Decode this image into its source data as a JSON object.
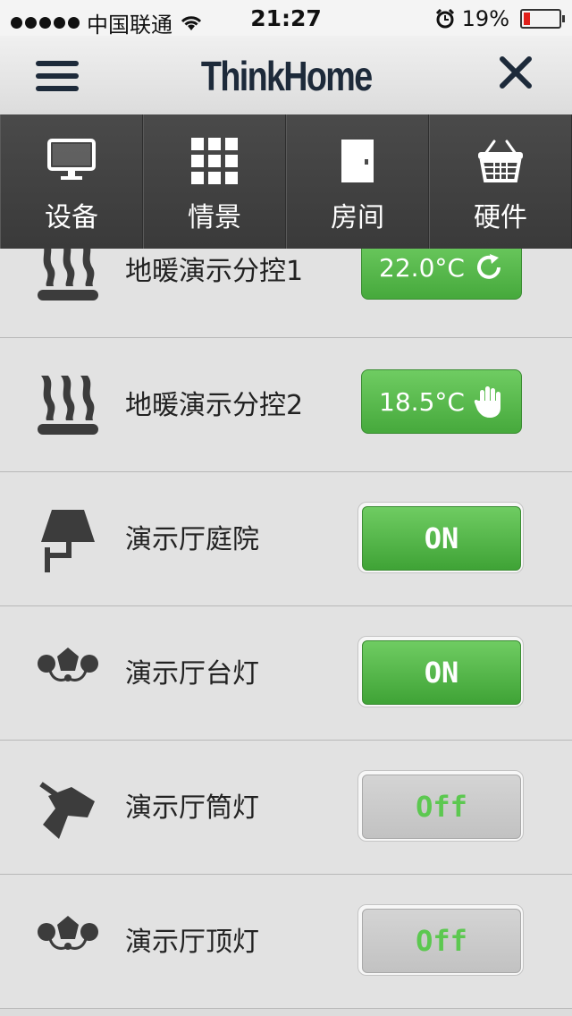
{
  "status_bar": {
    "carrier": "中国联通",
    "time": "21:27",
    "battery_percent": "19%",
    "battery_level": 0.19,
    "battery_color": "#e0201b"
  },
  "header": {
    "title": "ThinkHome"
  },
  "tabs": [
    {
      "label": "设备",
      "icon": "monitor-icon"
    },
    {
      "label": "情景",
      "icon": "grid-icon"
    },
    {
      "label": "房间",
      "icon": "door-icon"
    },
    {
      "label": "硬件",
      "icon": "basket-icon"
    }
  ],
  "devices": [
    {
      "name": "地暖演示分控1",
      "icon": "floor-heating-icon",
      "control": "22.0°C",
      "control_type": "temp",
      "control_icon": "refresh-icon"
    },
    {
      "name": "地暖演示分控2",
      "icon": "floor-heating-icon",
      "control": "18.5°C",
      "control_type": "temp",
      "control_icon": "hand-icon"
    },
    {
      "name": "演示厅庭院",
      "icon": "wall-lamp-icon",
      "control": "ON",
      "control_type": "on"
    },
    {
      "name": "演示厅台灯",
      "icon": "chandelier-icon",
      "control": "ON",
      "control_type": "on"
    },
    {
      "name": "演示厅筒灯",
      "icon": "spotlight-icon",
      "control": "Off",
      "control_type": "off"
    },
    {
      "name": "演示厅顶灯",
      "icon": "chandelier-icon",
      "control": "Off",
      "control_type": "off"
    }
  ],
  "colors": {
    "accent_green": "#46a93c",
    "off_text_green": "#5cc850",
    "header_navy": "#1d2a3a",
    "tabbar_bg": "#3a3a3a"
  }
}
